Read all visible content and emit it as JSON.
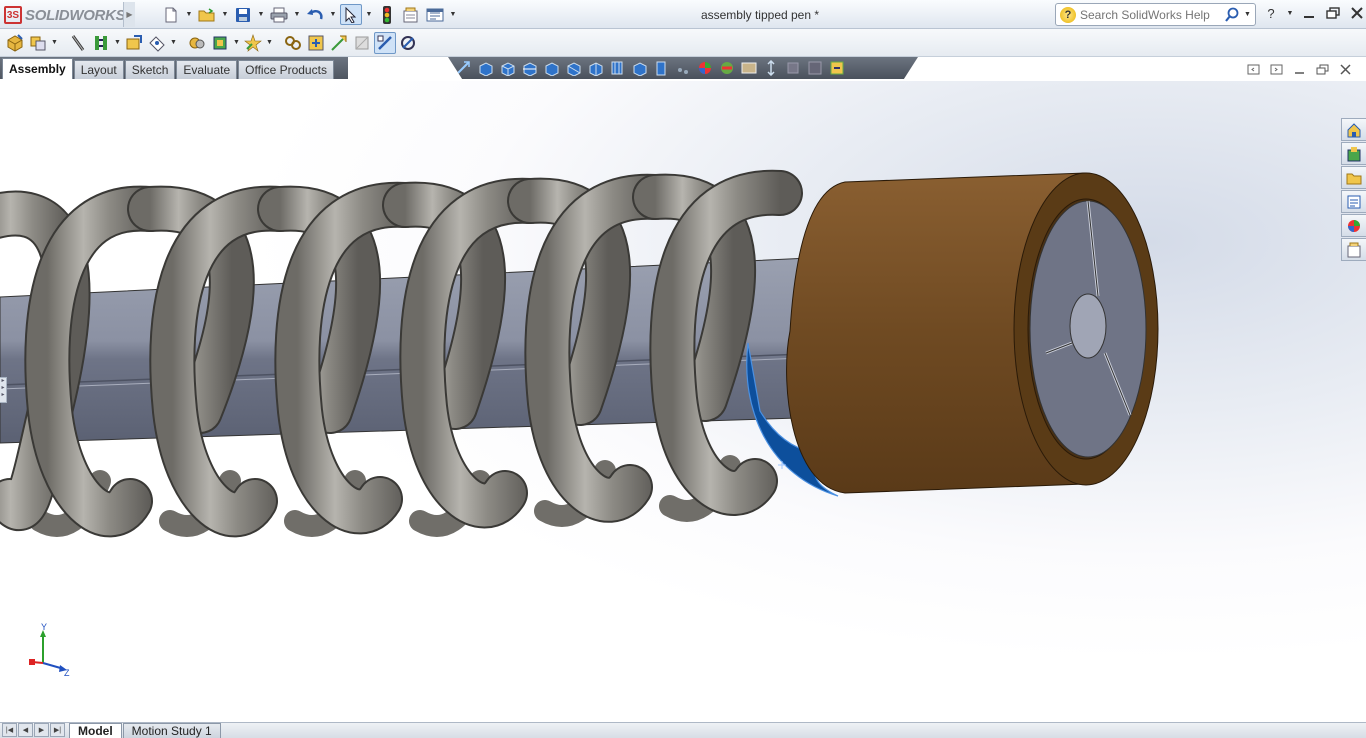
{
  "app": {
    "name": "SOLIDWORKS",
    "document_title": "assembly tipped pen *"
  },
  "search": {
    "placeholder": "Search SolidWorks Help"
  },
  "command_tabs": [
    {
      "label": "Assembly",
      "active": true
    },
    {
      "label": "Layout",
      "active": false
    },
    {
      "label": "Sketch",
      "active": false
    },
    {
      "label": "Evaluate",
      "active": false
    },
    {
      "label": "Office Products",
      "active": false
    }
  ],
  "bottom_tabs": [
    {
      "label": "Model",
      "active": true
    },
    {
      "label": "Motion Study 1",
      "active": false
    }
  ],
  "triad": {
    "y_label": "Y",
    "z_label": "Z"
  },
  "colors": {
    "spring": "#8f8d87",
    "shaft": "#7c8294",
    "cap": "#6e4a22",
    "selection": "#0d4f9c",
    "accent": "#2f6fbf"
  },
  "icons": {
    "quick_access": [
      "new-document-icon",
      "open-folder-icon",
      "save-icon",
      "print-icon",
      "undo-icon",
      "select-arrow-icon",
      "rebuild-traffic-light-icon",
      "file-properties-icon",
      "options-icon"
    ],
    "command_manager": [
      "insert-components-icon",
      "mate-icon",
      "linear-pattern-icon",
      "smart-fasteners-icon",
      "move-component-icon",
      "show-hidden-components-icon",
      "assembly-features-icon",
      "reference-geometry-icon",
      "new-motion-study-icon",
      "bill-of-materials-icon",
      "exploded-view-icon",
      "explode-line-sketch-icon",
      "interference-detection-icon",
      "instant3d-icon"
    ],
    "heads_up": [
      "zoom-to-fit-icon",
      "zoom-area-icon",
      "previous-view-icon",
      "section-view-icon",
      "view-orientation-icon",
      "display-style-icon",
      "hide-show-items-icon",
      "edit-appearance-icon",
      "apply-scene-icon",
      "view-settings-icon",
      "rotate-view-icon",
      "pan-icon",
      "zoom-in-out-icon",
      "close-view-icon"
    ],
    "task_pane": [
      "solidworks-resources-icon",
      "design-library-icon",
      "file-explorer-icon",
      "view-palette-icon",
      "appearances-scenes-icon",
      "custom-properties-icon"
    ]
  }
}
